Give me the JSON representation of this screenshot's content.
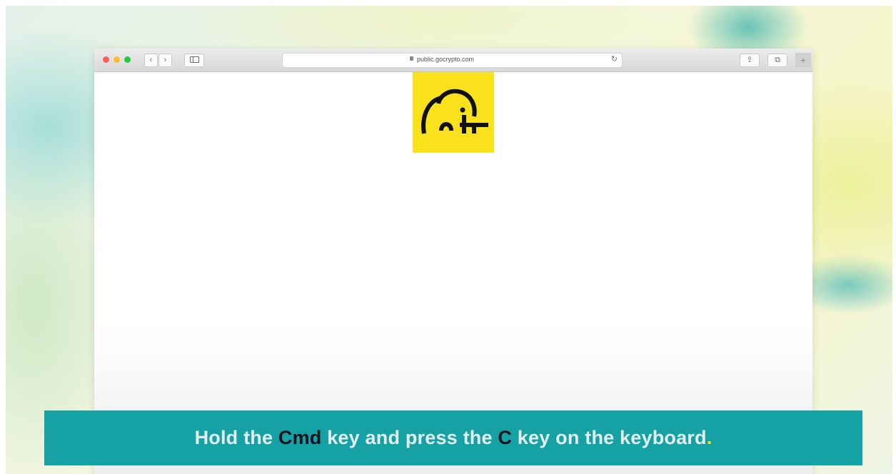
{
  "browser": {
    "address_url": "public.gocrypto.com",
    "nav_back_symbol": "‹",
    "nav_forward_symbol": "›",
    "reload_symbol": "↻",
    "share_symbol": "⇪",
    "tabs_symbol": "⧉",
    "new_tab_symbol": "+"
  },
  "page": {
    "logo_icon": "elephant-icon",
    "logo_background": "#f9e11b"
  },
  "caption": {
    "part1": "Hold the ",
    "key1": "Cmd",
    "part2": " key and press the ",
    "key2": "C",
    "part3": " key on the keyboard",
    "end": ".",
    "background": "#16a2a4"
  }
}
